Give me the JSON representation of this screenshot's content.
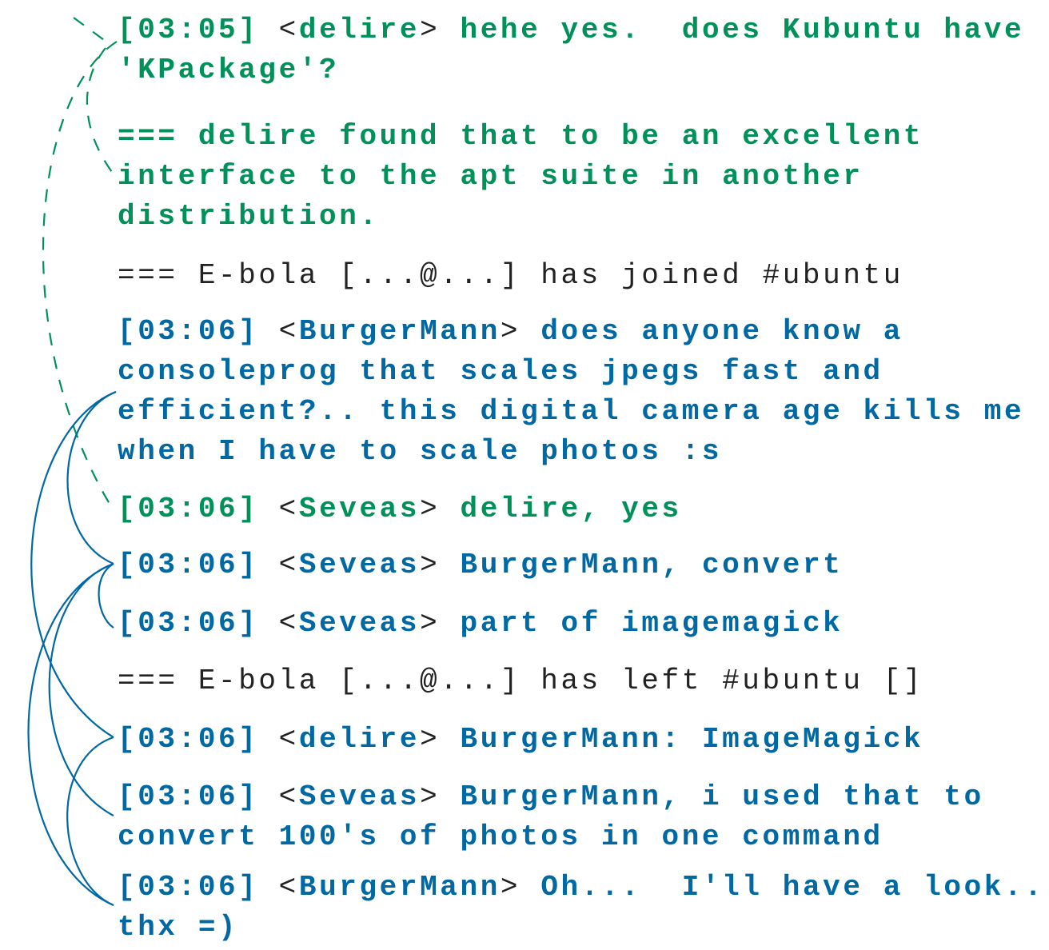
{
  "colors": {
    "green": "#00915a",
    "blue": "#0068a3",
    "system": "#222222"
  },
  "messages": [
    {
      "color": "green",
      "ts": "[03:05]",
      "nick": "delire",
      "lines": [
        "hehe yes.  does Kubuntu have",
        "'KPackage'?"
      ]
    },
    {
      "color": "green",
      "action": true,
      "lines": [
        "=== delire found that to be an excellent",
        "interface to the apt suite in another",
        "distribution."
      ]
    },
    {
      "color": "system",
      "lines": [
        "=== E-bola [...@...] has joined #ubuntu"
      ]
    },
    {
      "color": "blue",
      "ts": "[03:06]",
      "nick": "BurgerMann",
      "lines": [
        "does anyone know a",
        "consoleprog that scales jpegs fast and",
        "efficient?.. this digital camera age kills me",
        "when I have to scale photos :s"
      ]
    },
    {
      "color": "green",
      "ts": "[03:06]",
      "nick": "Seveas",
      "lines": [
        "delire, yes"
      ]
    },
    {
      "color": "blue",
      "ts": "[03:06]",
      "nick": "Seveas",
      "lines": [
        "BurgerMann, convert"
      ]
    },
    {
      "color": "blue",
      "ts": "[03:06]",
      "nick": "Seveas",
      "lines": [
        "part of imagemagick"
      ]
    },
    {
      "color": "system",
      "lines": [
        "=== E-bola [...@...] has left #ubuntu []"
      ]
    },
    {
      "color": "blue",
      "ts": "[03:06]",
      "nick": "delire",
      "lines": [
        "BurgerMann: ImageMagick"
      ]
    },
    {
      "color": "blue",
      "ts": "[03:06]",
      "nick": "Seveas",
      "lines": [
        "BurgerMann, i used that to",
        "convert 100's of photos in one command"
      ]
    },
    {
      "color": "blue",
      "ts": "[03:06]",
      "nick": "BurgerMann",
      "lines": [
        "Oh...  I'll have a look..",
        "thx =)"
      ]
    }
  ]
}
